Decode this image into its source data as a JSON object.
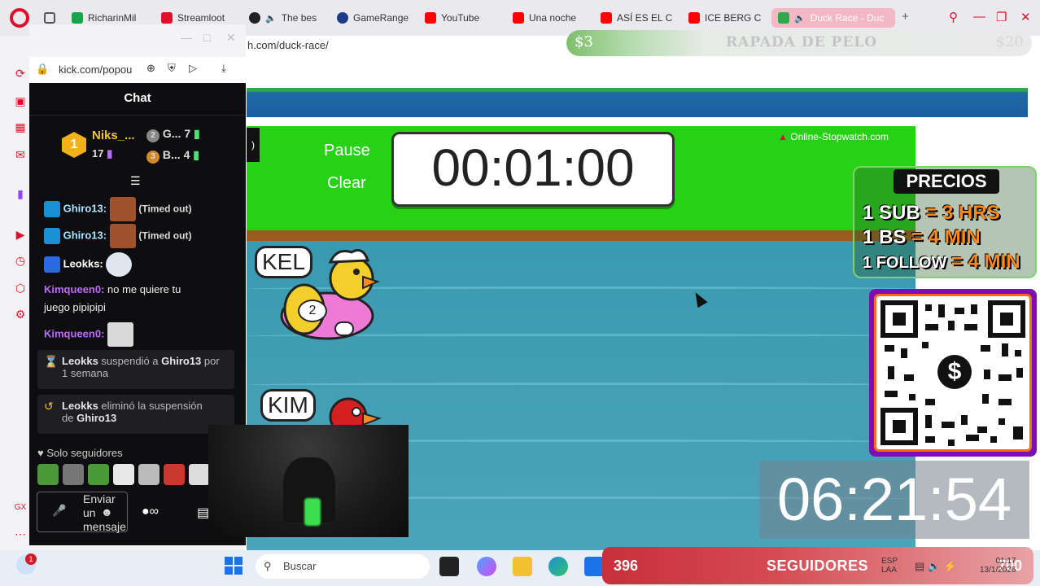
{
  "browser": {
    "tabs": [
      {
        "label": "RicharinMil",
        "color": "#1aa34a"
      },
      {
        "label": "Streamloot",
        "color": "#e0102c"
      },
      {
        "label": "The bes",
        "color": "#222"
      },
      {
        "label": "GameRange",
        "color": "#1e3a8a"
      },
      {
        "label": "YouTube",
        "color": "#ff0000"
      },
      {
        "label": "Una noche",
        "color": "#ff0000"
      },
      {
        "label": "ASÍ ES EL C",
        "color": "#ff0000"
      },
      {
        "label": "ICE BERG C",
        "color": "#ff0000"
      },
      {
        "label": "Duck Race - Duc",
        "color": "#2fa84a",
        "active": true
      }
    ],
    "new_tab": "+",
    "url_partial": "h.com/duck-race/"
  },
  "overlays": {
    "dollar_left": "$3",
    "dollar_mid": "RAPADA DE PELO",
    "dollar_right": "$20",
    "precios_title": "PRECIOS",
    "precios": [
      {
        "item": "1 SUB",
        "value": "= 3 HRS"
      },
      {
        "item": "1 BS",
        "value": "= 4 MIN"
      },
      {
        "item": "1 FOLLOW",
        "value": "= 4 MIN"
      }
    ],
    "qr_symbol": "$",
    "countdown": "06:21:54",
    "followers_count": "396",
    "followers_label": "SEGUIDORES",
    "followers_goal": "700"
  },
  "game": {
    "pause_label": "Pause",
    "clear_label": "Clear",
    "stopwatch": "00:01:00",
    "credit": "Online-Stopwatch.com",
    "ducks": [
      {
        "name": "KEL",
        "number": "2",
        "color": "#f2cf2a"
      },
      {
        "name": "KIM",
        "color": "#d42020"
      }
    ]
  },
  "popout": {
    "url": "kick.com/popou",
    "chat_title": "Chat",
    "leaderboard": [
      {
        "rank": "1",
        "name": "Niks_...",
        "count": "17"
      },
      {
        "rank": "2",
        "name": "G...",
        "count": "7"
      },
      {
        "rank": "3",
        "name": "B...",
        "count": "4"
      }
    ],
    "messages": [
      {
        "user": "Ghiro13:",
        "status": "(Timed out)"
      },
      {
        "user": "Ghiro13:",
        "status": "(Timed out)"
      },
      {
        "user": "Leokks:"
      },
      {
        "user": "Kimqueen0:",
        "text_line1": "no me quiere tu",
        "text_line2": "juego pipipipi"
      },
      {
        "user": "Kimqueen0:"
      }
    ],
    "system": [
      {
        "actor": "Leokks",
        "verb": " suspendió a ",
        "target": "Ghiro13",
        "rest1": " por",
        "rest2": "1 semana"
      },
      {
        "actor": "Leokks",
        "verb": " eliminó la suspensión",
        "rest2_pre": "de ",
        "target": "Ghiro13"
      }
    ],
    "followers_only": "Solo seguidores",
    "input_placeholder_1": "Enviar",
    "input_placeholder_2": "un",
    "input_placeholder_3": "mensaje"
  },
  "taskbar": {
    "search": "Buscar",
    "notification_count": "1",
    "lang_1": "ESP",
    "lang_2": "LAA",
    "time": "01:17",
    "date": "13/1/2026"
  }
}
